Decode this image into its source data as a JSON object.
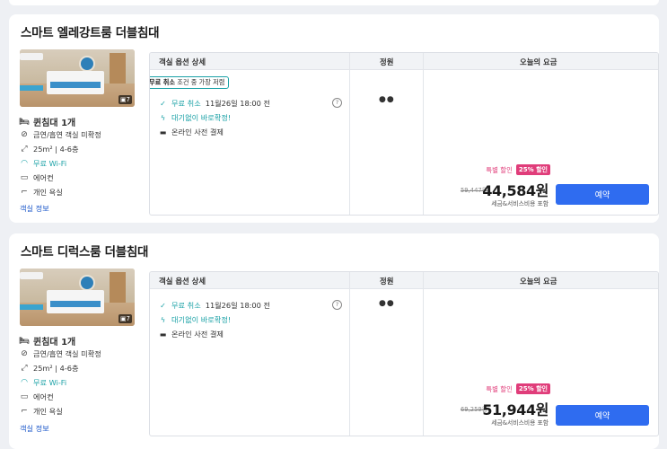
{
  "rooms": [
    {
      "title": "스마트 엘레강트룸 더블침대",
      "photo_count": "7",
      "bed_type": "퀸침대 1개",
      "amenities": [
        "금연/흡연 객실 미확정",
        "25m² | 4-6층",
        "무료 Wi-Fi",
        "에어컨",
        "개인 욕실"
      ],
      "room_info_link": "객실 정보",
      "table_headers": {
        "options": "객실 옵션 상세",
        "capacity": "정원",
        "price": "오늘의 요금"
      },
      "tag": {
        "bold": "무료 취소",
        "rest": " 조건 중 가장 저렴"
      },
      "free_cancel": "무료 취소",
      "cancel_time": "11월26일 18:00 전",
      "instant_confirm": "대기없이 바로확정!",
      "payment": "온라인 사전 결제",
      "discount_label": "특별 할인",
      "discount_badge": "25% 할인",
      "original_price": "59,447원",
      "final_price": "44,584원",
      "tax_note": "세금&서비스비용 포함",
      "book_label": "예약"
    },
    {
      "title": "스마트 디럭스룸 더블침대",
      "photo_count": "7",
      "bed_type": "퀸침대 1개",
      "amenities": [
        "금연/흡연 객실 미확정",
        "25m² | 4-6층",
        "무료 Wi-Fi",
        "에어컨",
        "개인 욕실"
      ],
      "room_info_link": "객실 정보",
      "table_headers": {
        "options": "객실 옵션 상세",
        "capacity": "정원",
        "price": "오늘의 요금"
      },
      "free_cancel": "무료 취소",
      "cancel_time": "11월26일 18:00 전",
      "instant_confirm": "대기없이 바로확정!",
      "payment": "온라인 사전 결제",
      "discount_label": "특별 할인",
      "discount_badge": "25% 할인",
      "original_price": "69,259원",
      "final_price": "51,944원",
      "tax_note": "세금&서비스비용 포함",
      "book_label": "예약"
    }
  ],
  "icons": {
    "bed": "bed-icon",
    "smoking": "no-smoking-icon",
    "size": "room-size-icon",
    "wifi": "wifi-icon",
    "ac": "air-conditioner-icon",
    "bath": "shower-icon",
    "check": "check-circle-icon",
    "bolt": "lightning-icon",
    "card": "credit-card-icon",
    "help": "question-icon",
    "guests": "person-icon",
    "camera": "photo-count-icon"
  },
  "colors": {
    "accent": "#2f6cf0",
    "teal": "#1aa1a6",
    "discount": "#e03d7a"
  }
}
